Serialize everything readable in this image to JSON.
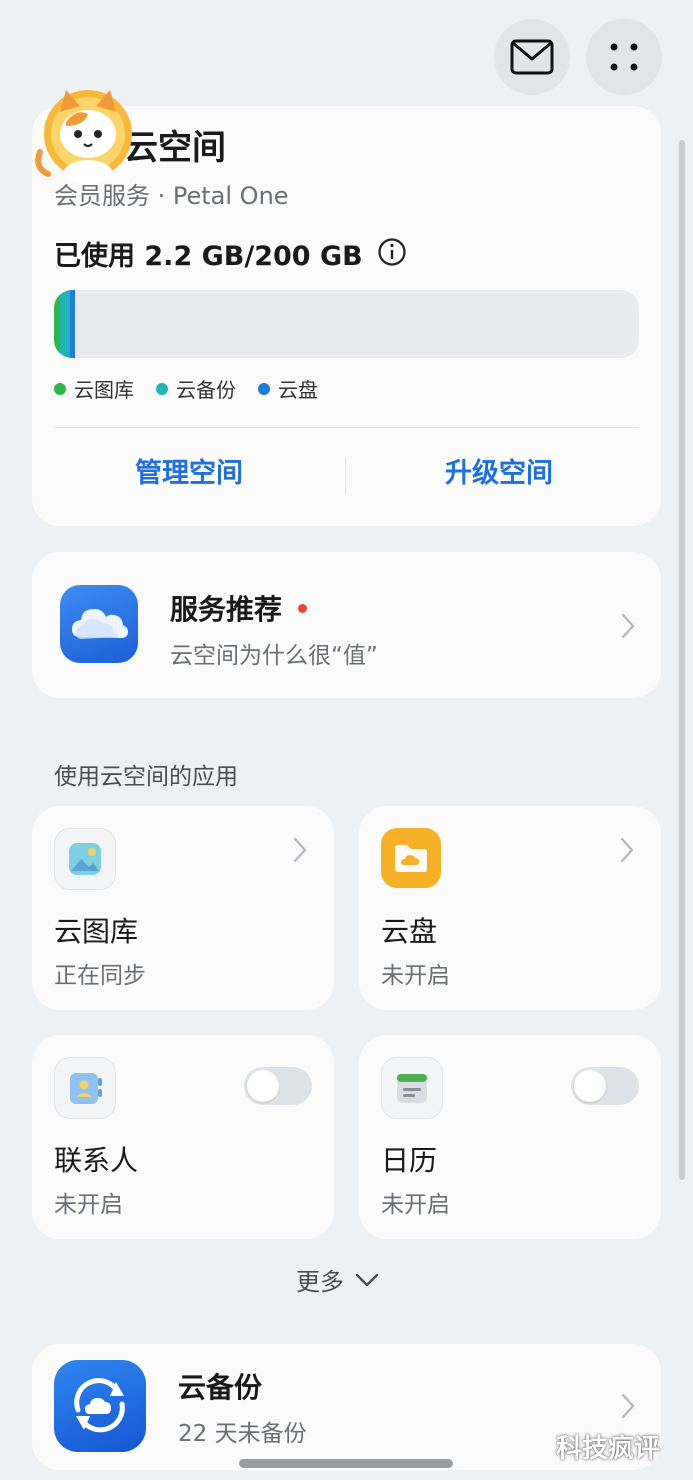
{
  "header": {
    "mail_icon": "envelope-icon",
    "more_icon": "dots-grid-icon"
  },
  "storage_card": {
    "title": "我的云空间",
    "subtitle": "会员服务 · Petal One",
    "used_text": "已使用 2.2 GB/200 GB",
    "info_icon": "info-icon",
    "used_gb": 2.2,
    "total_gb": 200,
    "legend": [
      {
        "label": "云图库",
        "color": "#2db64a"
      },
      {
        "label": "云备份",
        "color": "#1fb5b4"
      },
      {
        "label": "云盘",
        "color": "#1f7be0"
      }
    ],
    "manage_label": "管理空间",
    "upgrade_label": "升级空间"
  },
  "recommend": {
    "title": "服务推荐",
    "subtitle": "云空间为什么很“值”",
    "icon": "cloud-icon",
    "badge_color": "#e5493a"
  },
  "apps_section": {
    "heading": "使用云空间的应用",
    "apps": [
      {
        "name": "云图库",
        "status": "正在同步",
        "icon": "gallery-icon",
        "control": "chevron"
      },
      {
        "name": "云盘",
        "status": "未开启",
        "icon": "cloud-drive-icon",
        "control": "chevron"
      },
      {
        "name": "联系人",
        "status": "未开启",
        "icon": "contacts-icon",
        "control": "toggle",
        "enabled": false
      },
      {
        "name": "日历",
        "status": "未开启",
        "icon": "calendar-icon",
        "control": "toggle",
        "enabled": false
      }
    ],
    "more_label": "更多"
  },
  "backup": {
    "title": "云备份",
    "subtitle": "22 天未备份",
    "icon": "cloud-backup-icon"
  },
  "watermark": "科技疯评",
  "colors": {
    "accent": "#1f6fe0",
    "background": "#eef1f4",
    "card": "#fbfbfc"
  }
}
